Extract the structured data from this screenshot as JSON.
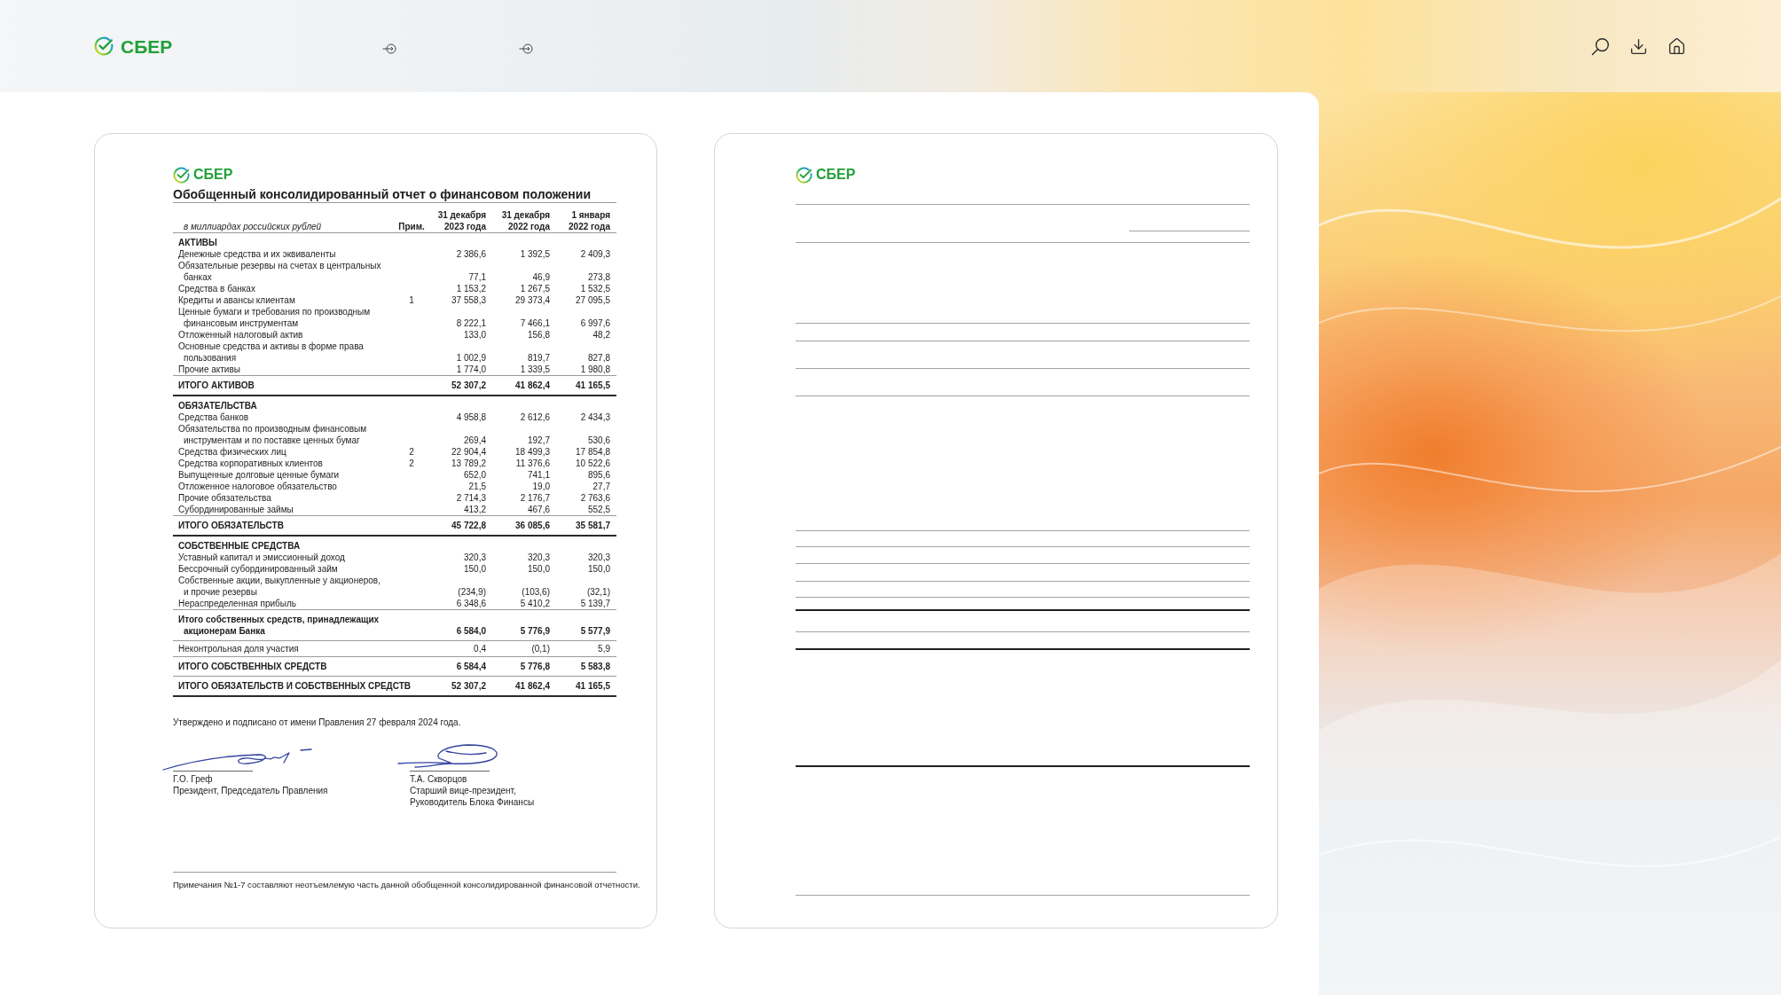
{
  "header": {
    "logo_text": "СБЕР"
  },
  "pages": [
    {
      "kind": "statement",
      "logo_text": "СБЕР",
      "title": "Обобщенный консолидированный отчет о финансовом положении",
      "table": {
        "unit_caption": "в миллиардах российских рублей",
        "columns": [
          "Прим.",
          "31 декабря\n2023 года",
          "31 декабря\n2022 года",
          "1 января\n2022 года"
        ],
        "rows": [
          {
            "kind": "section",
            "label": "АКТИВЫ"
          },
          {
            "kind": "item",
            "label": "Денежные средства и их эквиваленты",
            "values": [
              "2 386,6",
              "1 392,5",
              "2 409,3"
            ]
          },
          {
            "kind": "item",
            "label": "Обязательные резервы на счетах в центральных\nбанках",
            "values": [
              "77,1",
              "46,9",
              "273,8"
            ]
          },
          {
            "kind": "item",
            "label": "Средства в банках",
            "values": [
              "1 153,2",
              "1 267,5",
              "1 532,5"
            ]
          },
          {
            "kind": "item",
            "label": "Кредиты и авансы клиентам",
            "note": "1",
            "values": [
              "37 558,3",
              "29 373,4",
              "27 095,5"
            ]
          },
          {
            "kind": "item",
            "label": "Ценные бумаги и требования по производным\nфинансовым инструментам",
            "values": [
              "8 222,1",
              "7 466,1",
              "6 997,6"
            ]
          },
          {
            "kind": "item",
            "label": "Отложенный налоговый актив",
            "values": [
              "133,0",
              "156,8",
              "48,2"
            ]
          },
          {
            "kind": "item",
            "label": "Основные средства и активы в форме права\nпользования",
            "values": [
              "1 002,9",
              "819,7",
              "827,8"
            ]
          },
          {
            "kind": "item",
            "label": "Прочие активы",
            "values": [
              "1 774,0",
              "1 339,5",
              "1 980,8"
            ]
          },
          {
            "kind": "total",
            "label": "ИТОГО АКТИВОВ",
            "values": [
              "52 307,2",
              "41 862,4",
              "41 165,5"
            ]
          },
          {
            "kind": "section",
            "label": "ОБЯЗАТЕЛЬСТВА"
          },
          {
            "kind": "item",
            "label": "Средства банков",
            "values": [
              "4 958,8",
              "2 612,6",
              "2 434,3"
            ]
          },
          {
            "kind": "item",
            "label": "Обязательства по производным финансовым\nинструментам и по поставке ценных бумаг",
            "values": [
              "269,4",
              "192,7",
              "530,6"
            ]
          },
          {
            "kind": "item",
            "label": "Средства физических лиц",
            "note": "2",
            "values": [
              "22 904,4",
              "18 499,3",
              "17 854,8"
            ]
          },
          {
            "kind": "item",
            "label": "Средства корпоративных клиентов",
            "note": "2",
            "values": [
              "13 789,2",
              "11 376,6",
              "10 522,6"
            ]
          },
          {
            "kind": "item",
            "label": "Выпущенные долговые ценные бумаги",
            "values": [
              "652,0",
              "741,1",
              "895,6"
            ]
          },
          {
            "kind": "item",
            "label": "Отложенное налоговое обязательство",
            "values": [
              "21,5",
              "19,0",
              "27,7"
            ]
          },
          {
            "kind": "item",
            "label": "Прочие обязательства",
            "values": [
              "2 714,3",
              "2 176,7",
              "2 763,6"
            ]
          },
          {
            "kind": "item",
            "label": "Субординированные займы",
            "values": [
              "413,2",
              "467,6",
              "552,5"
            ]
          },
          {
            "kind": "total",
            "label": "ИТОГО ОБЯЗАТЕЛЬСТВ",
            "values": [
              "45 722,8",
              "36 085,6",
              "35 581,7"
            ]
          },
          {
            "kind": "section",
            "label": "СОБСТВЕННЫЕ СРЕДСТВА"
          },
          {
            "kind": "item",
            "label": "Уставный капитал и эмиссионный доход",
            "values": [
              "320,3",
              "320,3",
              "320,3"
            ]
          },
          {
            "kind": "item",
            "label": "Бессрочный субординированный займ",
            "values": [
              "150,0",
              "150,0",
              "150,0"
            ]
          },
          {
            "kind": "item",
            "label": "Собственные акции, выкупленные у акционеров,\nи прочие резервы",
            "values": [
              "(234,9)",
              "(103,6)",
              "(32,1)"
            ]
          },
          {
            "kind": "item",
            "label": "Нераспределенная прибыль",
            "values": [
              "6 348,6",
              "5 410,2",
              "5 139,7"
            ]
          },
          {
            "kind": "subtotal",
            "label": "Итого собственных средств, принадлежащих\nакционерам Банка",
            "values": [
              "6 584,0",
              "5 776,9",
              "5 577,9"
            ]
          },
          {
            "kind": "item",
            "label": "Неконтрольная доля участия",
            "values": [
              "0,4",
              "(0,1)",
              "5,9"
            ]
          },
          {
            "kind": "subtotal",
            "label": "ИТОГО СОБСТВЕННЫХ СРЕДСТВ",
            "values": [
              "6 584,4",
              "5 776,8",
              "5 583,8"
            ]
          },
          {
            "kind": "total",
            "label": "ИТОГО ОБЯЗАТЕЛЬСТВ И СОБСТВЕННЫХ СРЕДСТВ",
            "values": [
              "52 307,2",
              "41 862,4",
              "41 165,5"
            ]
          }
        ]
      },
      "approval": "Утверждено и подписано от имени Правления 27 февраля 2024 года.",
      "signatories": [
        {
          "name": "Г.О. Греф",
          "position": "Президент, Председатель Правления"
        },
        {
          "name": "Т.А. Скворцов",
          "position": "Старший вице-президент,\nРуководитель Блока Финансы"
        }
      ],
      "footnote": "Примечания №1-7 составляют неотъемлемую часть данной обобщенной консолидированной финансовой отчетности."
    },
    {
      "kind": "ruled",
      "logo_text": "СБЕР"
    }
  ]
}
